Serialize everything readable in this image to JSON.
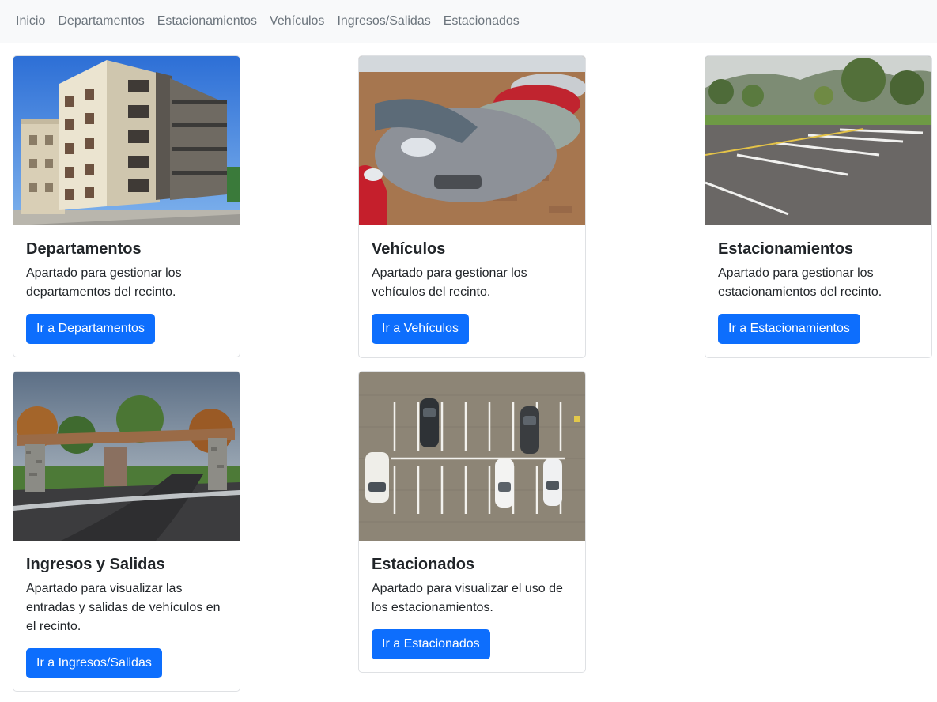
{
  "nav": {
    "items": [
      {
        "label": "Inicio"
      },
      {
        "label": "Departamentos"
      },
      {
        "label": "Estacionamientos"
      },
      {
        "label": "Vehículos"
      },
      {
        "label": "Ingresos/Salidas"
      },
      {
        "label": "Estacionados"
      }
    ]
  },
  "cards": [
    {
      "title": "Departamentos",
      "text": "Apartado para gestionar los departamentos del recinto.",
      "button": "Ir a Departamentos",
      "image": "apartment-building-photo"
    },
    {
      "title": "Vehículos",
      "text": "Apartado para gestionar los vehículos del recinto.",
      "button": "Ir a Vehículos",
      "image": "parked-cars-photo"
    },
    {
      "title": "Estacionamientos",
      "text": "Apartado para gestionar los estacionamientos del recinto.",
      "button": "Ir a Estacionamientos",
      "image": "empty-parking-lot-photo"
    },
    {
      "title": "Ingresos y Salidas",
      "text": "Apartado para visualizar las entradas y salidas de vehículos en el recinto.",
      "button": "Ir a Ingresos/Salidas",
      "image": "gated-entrance-photo"
    },
    {
      "title": "Estacionados",
      "text": "Apartado para visualizar el uso de los estacionamientos.",
      "button": "Ir a Estacionados",
      "image": "aerial-parking-photo"
    }
  ],
  "colors": {
    "primary": "#0d6efd",
    "navbar_bg": "#f8f9fa",
    "nav_text": "#6c757d",
    "card_border": "#dfe1e4"
  }
}
